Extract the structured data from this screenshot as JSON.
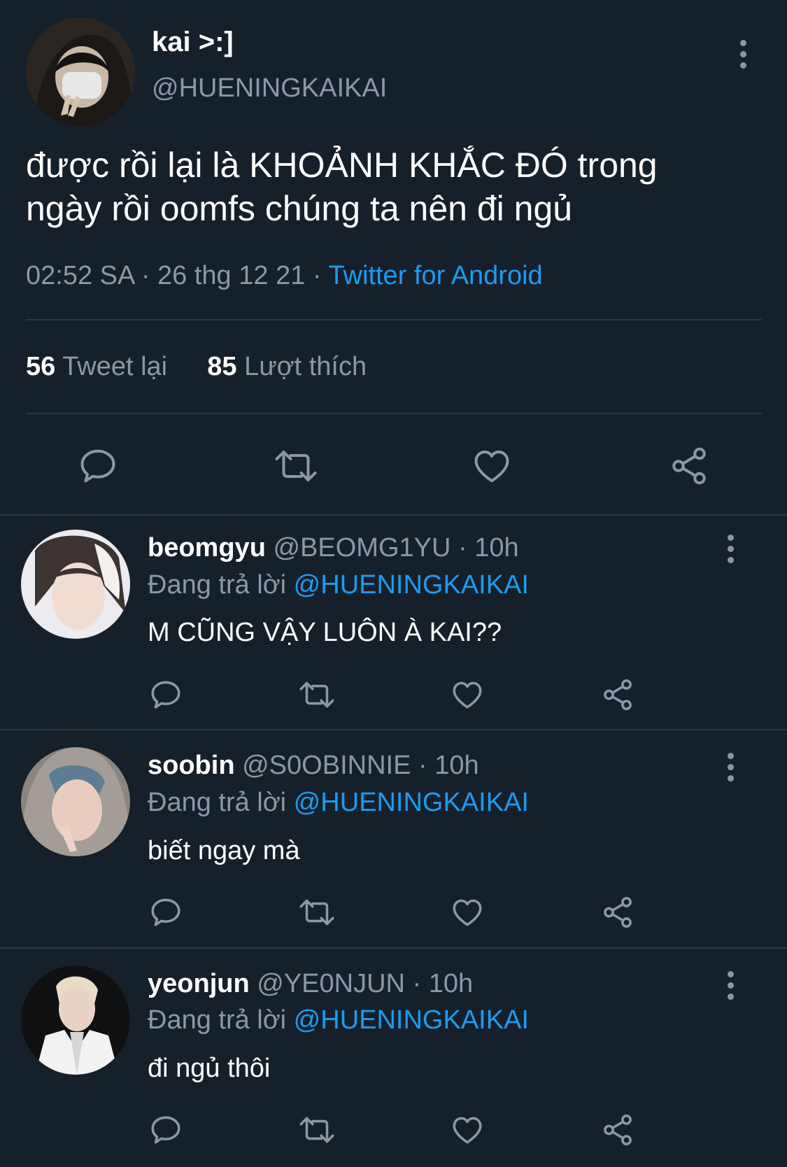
{
  "main_tweet": {
    "display_name": "kai >:]",
    "handle": "@HUENINGKAIKAI",
    "text_line1": "được rồi lại là KHOẢNH KHẮC ĐÓ trong",
    "text_line2": "ngày rồi oomfs chúng ta nên đi ngủ",
    "time": "02:52 SA",
    "date": "26 thg 12 21",
    "separator": "·",
    "source": "Twitter for Android",
    "retweet_count": "56",
    "retweet_label": "Tweet lại",
    "like_count": "85",
    "like_label": "Lượt thích"
  },
  "replies": [
    {
      "name": "beomgyu",
      "handle": "@BEOMG1YU",
      "time": "· 10h",
      "replying_label": "Đang trả lời",
      "replying_to": "@HUENINGKAIKAI",
      "text": "M CŨNG VẬY LUÔN À KAI??"
    },
    {
      "name": "soobin",
      "handle": "@S0OBINNIE",
      "time": "· 10h",
      "replying_label": "Đang trả lời",
      "replying_to": "@HUENINGKAIKAI",
      "text": "biết ngay mà"
    },
    {
      "name": "yeonjun",
      "handle": "@YE0NJUN",
      "time": "· 10h",
      "replying_label": "Đang trả lời",
      "replying_to": "@HUENINGKAIKAI",
      "text": "đi ngủ thôi"
    }
  ],
  "icons": [
    "reply-icon",
    "retweet-icon",
    "like-icon",
    "share-icon",
    "more-icon"
  ],
  "colors": {
    "background": "#16202b",
    "accent": "#1d9bf0",
    "muted": "#8a98a6",
    "divider": "#2c3744"
  }
}
